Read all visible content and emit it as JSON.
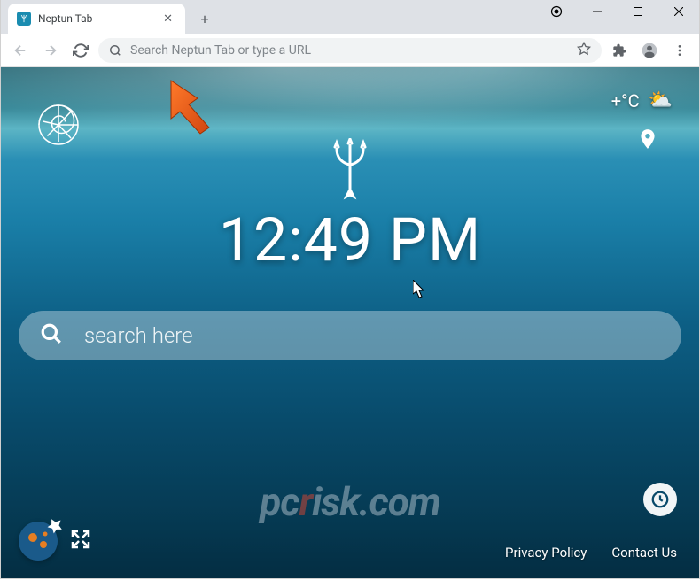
{
  "tab": {
    "title": "Neptun Tab"
  },
  "omnibox": {
    "placeholder": "Search Neptun Tab or type a URL"
  },
  "weather": {
    "temp": "+°C"
  },
  "clock": {
    "time": "12:49 PM"
  },
  "search": {
    "placeholder": "search here"
  },
  "footer": {
    "privacy": "Privacy Policy",
    "contact": "Contact Us"
  },
  "watermark": {
    "prefix": "pc",
    "r": "r",
    "suffix": "isk.com"
  }
}
